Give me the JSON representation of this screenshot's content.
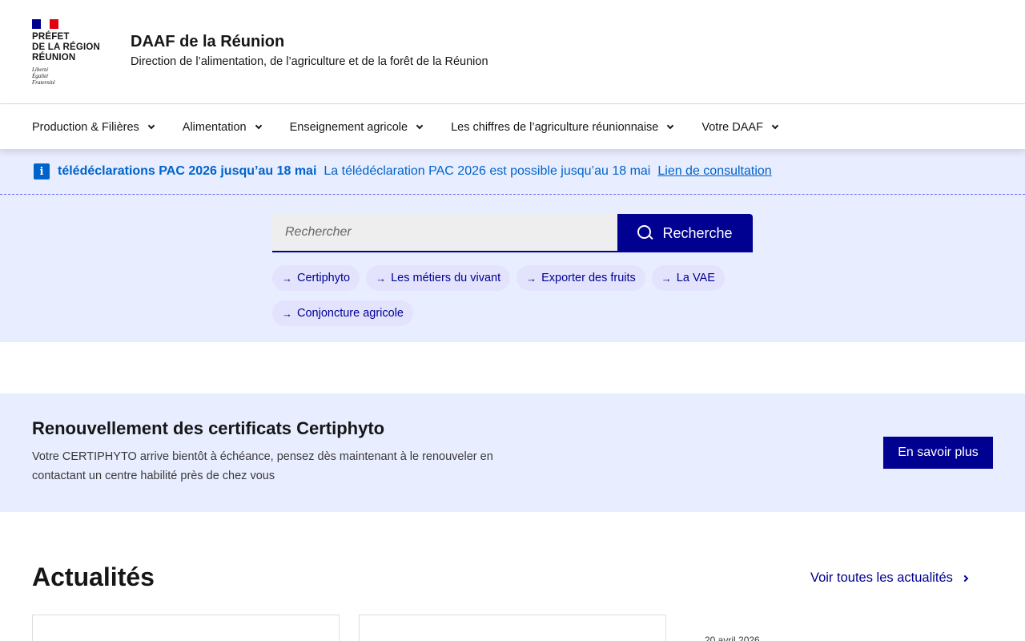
{
  "header": {
    "logo_lines": [
      "PRÉFET",
      "DE LA RÉGION",
      "RÉUNION"
    ],
    "devise": [
      "Liberté",
      "Égalité",
      "Fraternité"
    ],
    "site_title": "DAAF de la Réunion",
    "site_subtitle": "Direction de l’alimentation, de l’agriculture et de la forêt de la Réunion",
    "flag_colors": [
      "#000091",
      "#ffffff",
      "#e1000f"
    ]
  },
  "nav": {
    "items": [
      {
        "label": "Production & Filières"
      },
      {
        "label": "Alimentation"
      },
      {
        "label": "Enseignement agricole"
      },
      {
        "label": "Les chiffres de l’agriculture réunionnaise"
      },
      {
        "label": "Votre DAAF"
      }
    ]
  },
  "notice": {
    "icon": "info-icon",
    "title": "télédéclarations PAC 2026 jusqu’au 18 mai",
    "text": "La télédéclaration PAC 2026 est possible jusqu’au 18 mai",
    "link": "Lien de consultation"
  },
  "search": {
    "placeholder": "Rechercher",
    "button_label": "Recherche",
    "tags": [
      {
        "label": "Certiphyto"
      },
      {
        "label": "Les métiers du vivant"
      },
      {
        "label": "Exporter des fruits"
      },
      {
        "label": "La VAE"
      },
      {
        "label": "Conjoncture agricole"
      }
    ]
  },
  "banner": {
    "title": "Renouvellement des certificats Certiphyto",
    "text": "Votre CERTIPHYTO arrive bientôt à échéance, pensez dès maintenant à le renouveler en contactant un centre habilité près de chez vous",
    "button_label": "En savoir plus"
  },
  "news": {
    "title": "Actualités",
    "see_all": "Voir toutes les actualités",
    "date": "20 avril 2026"
  },
  "colors": {
    "primary": "#000091",
    "info": "#0063cb",
    "light_blue_bg": "#e8edff"
  }
}
